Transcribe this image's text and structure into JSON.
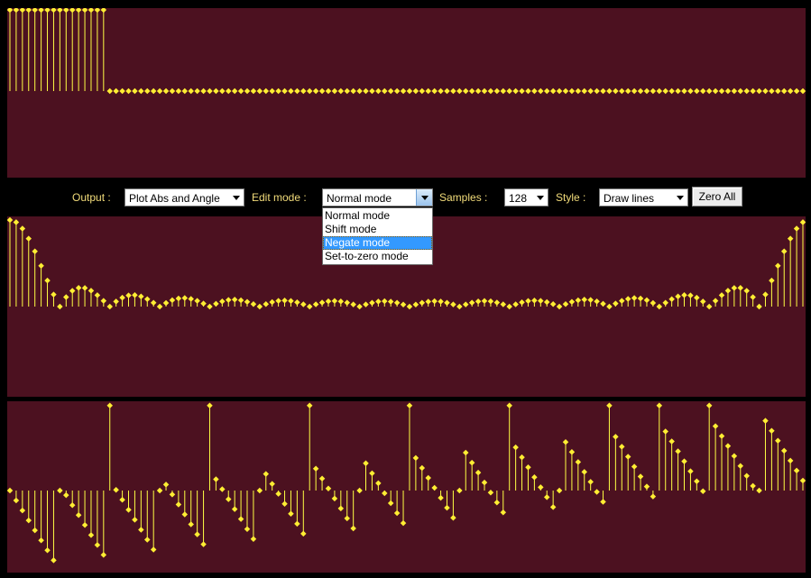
{
  "controls": {
    "output_label": "Output :",
    "output_value": "Plot Abs and Angle",
    "edit_mode_label": "Edit mode :",
    "edit_mode_value": "Normal mode",
    "samples_label": "Samples :",
    "samples_value": "128",
    "style_label": "Style :",
    "style_value": "Draw lines",
    "zero_all_label": "Zero All"
  },
  "edit_mode_dropdown": {
    "options": [
      "Normal mode",
      "Shift mode",
      "Negate mode",
      "Set-to-zero mode"
    ],
    "highlighted": "Negate mode"
  },
  "colors": {
    "plot_background": "#4c1120",
    "stem": "#ffff44",
    "marker": "#ffee33",
    "label_text": "#f2dc7a",
    "highlight": "#3399ff"
  },
  "chart_data": [
    {
      "type": "stem",
      "name": "input-signal",
      "samples": 128,
      "nonzero_count": 16,
      "high_value": 1,
      "low_value": 0
    },
    {
      "type": "stem",
      "name": "dft-magnitude",
      "samples": 128,
      "peak_value": 16,
      "pattern": "abs(sin(pi*16*k/128)/sin(pi*k/128))"
    },
    {
      "type": "stem",
      "name": "dft-angle",
      "samples": 128,
      "range": "-pi..pi",
      "pattern": "wrap(-pi*15*k/128)"
    }
  ]
}
